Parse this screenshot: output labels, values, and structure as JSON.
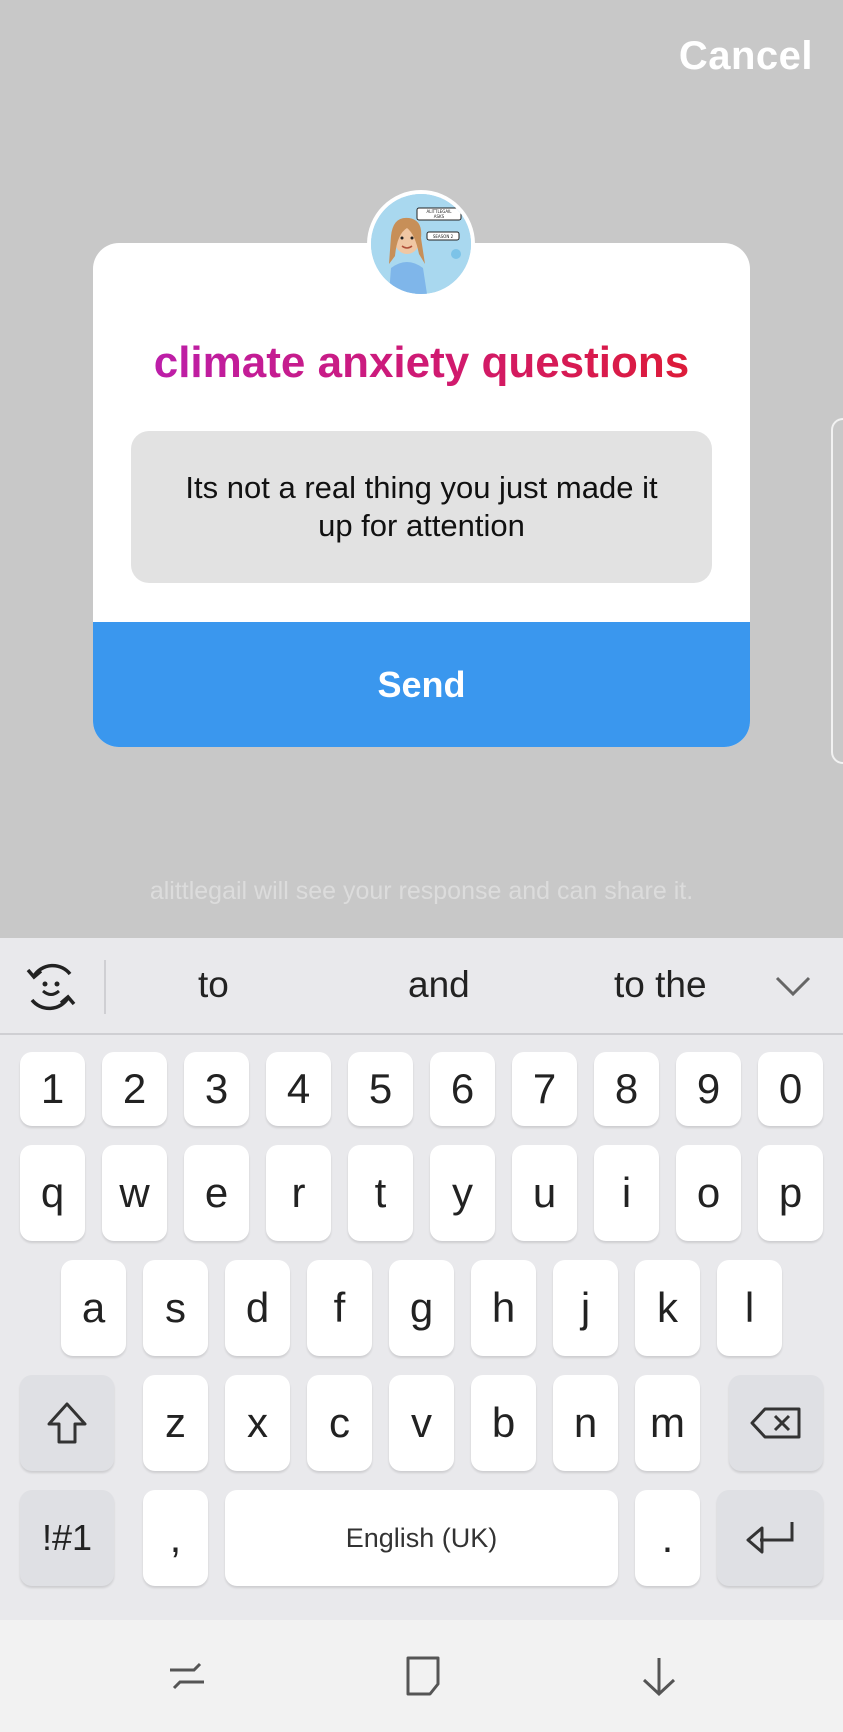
{
  "header": {
    "cancel_label": "Cancel"
  },
  "card": {
    "title": "climate anxiety questions",
    "answer": "Its not a real thing you just made it up for attention",
    "send_label": "Send",
    "avatar_sticker_texts": [
      "ALITTLEGAIL ASKS",
      "SEASON 2"
    ]
  },
  "disclaimer": "alittlegail will see your response and can share it.",
  "keyboard": {
    "suggestions": [
      "to",
      "and",
      "to the"
    ],
    "number_row": [
      "1",
      "2",
      "3",
      "4",
      "5",
      "6",
      "7",
      "8",
      "9",
      "0"
    ],
    "row1": [
      "q",
      "w",
      "e",
      "r",
      "t",
      "y",
      "u",
      "i",
      "o",
      "p"
    ],
    "row2": [
      "a",
      "s",
      "d",
      "f",
      "g",
      "h",
      "j",
      "k",
      "l"
    ],
    "row3": [
      "z",
      "x",
      "c",
      "v",
      "b",
      "n",
      "m"
    ],
    "symbols_label": "!#1",
    "comma_label": ",",
    "space_label": "English (UK)",
    "period_label": "."
  },
  "icons": {
    "suggestion_toggle": "emoji-refresh-icon",
    "collapse": "chevron-down-icon",
    "shift": "shift-icon",
    "backspace": "backspace-icon",
    "enter": "enter-icon",
    "nav_recent": "recent-apps-icon",
    "nav_home": "home-icon",
    "nav_back": "back-icon"
  },
  "colors": {
    "send_button": "#3a97ee",
    "title_gradient": [
      "#b81fb5",
      "#e01b2b"
    ],
    "backdrop": "#c8c8c8"
  }
}
